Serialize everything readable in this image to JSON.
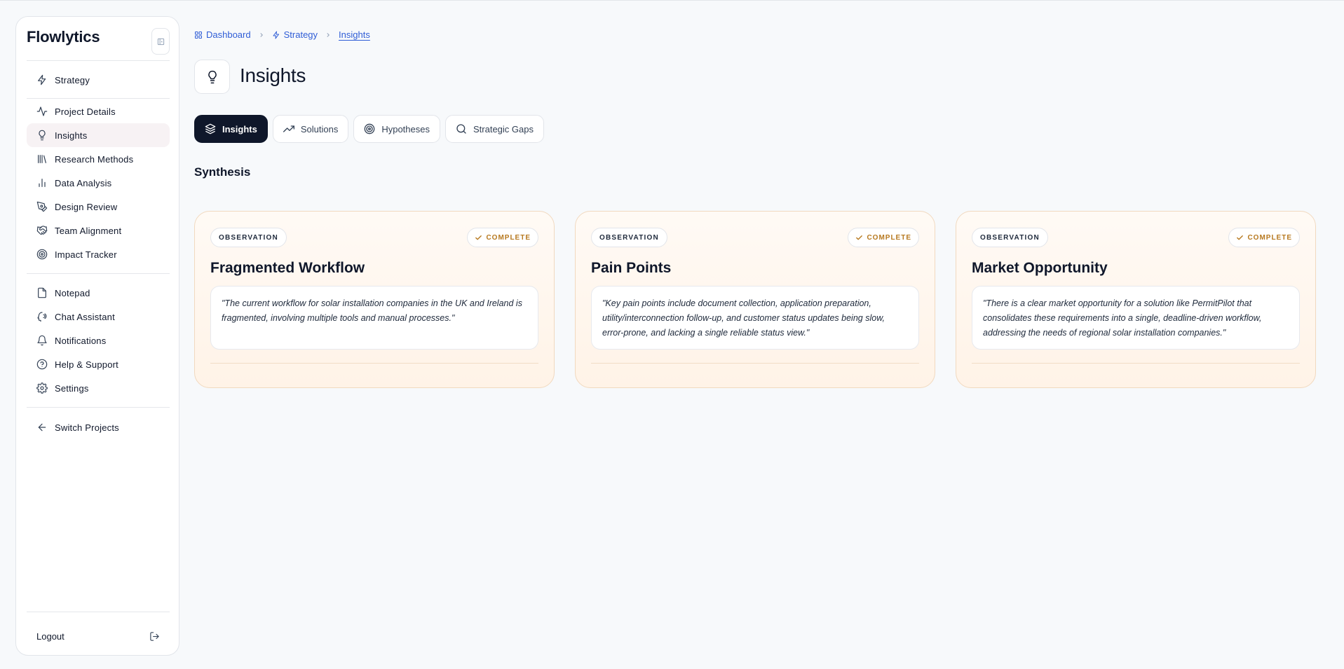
{
  "app": {
    "brand": "Flowlytics"
  },
  "sidebar": {
    "groups": [
      [
        {
          "label": "Strategy",
          "icon": "bolt-icon"
        }
      ],
      [
        {
          "label": "Project Details",
          "icon": "activity-icon"
        },
        {
          "label": "Insights",
          "icon": "lightbulb-icon",
          "active": true
        },
        {
          "label": "Research Methods",
          "icon": "library-icon"
        },
        {
          "label": "Data Analysis",
          "icon": "bar-chart-icon"
        },
        {
          "label": "Design Review",
          "icon": "pen-tool-icon"
        },
        {
          "label": "Team Alignment",
          "icon": "handshake-icon"
        },
        {
          "label": "Impact Tracker",
          "icon": "target-icon"
        }
      ],
      [
        {
          "label": "Notepad",
          "icon": "file-icon"
        },
        {
          "label": "Chat Assistant",
          "icon": "chat-assistant-icon"
        },
        {
          "label": "Notifications",
          "icon": "bell-icon"
        },
        {
          "label": "Help & Support",
          "icon": "help-circle-icon"
        },
        {
          "label": "Settings",
          "icon": "gear-icon"
        }
      ],
      [
        {
          "label": "Switch Projects",
          "icon": "arrow-left-icon"
        }
      ]
    ],
    "logout_label": "Logout"
  },
  "breadcrumb": [
    {
      "label": "Dashboard",
      "icon": "grid-icon"
    },
    {
      "label": "Strategy",
      "icon": "bolt-icon"
    },
    {
      "label": "Insights",
      "current": true
    }
  ],
  "page": {
    "title": "Insights",
    "icon": "lightbulb-icon"
  },
  "tabs": [
    {
      "label": "Insights",
      "icon": "layers-icon",
      "active": true
    },
    {
      "label": "Solutions",
      "icon": "trending-up-icon"
    },
    {
      "label": "Hypotheses",
      "icon": "target-icon"
    },
    {
      "label": "Strategic Gaps",
      "icon": "search-icon"
    }
  ],
  "section": {
    "title": "Synthesis"
  },
  "cards": [
    {
      "badge": "OBSERVATION",
      "status": "COMPLETE",
      "title": "Fragmented Workflow",
      "quote": "\"The current workflow for solar installation companies in the UK and Ireland is fragmented, involving multiple tools and manual processes.\""
    },
    {
      "badge": "OBSERVATION",
      "status": "COMPLETE",
      "title": "Pain Points",
      "quote": "\"Key pain points include document collection, application preparation, utility/interconnection follow-up, and customer status updates being slow, error-prone, and lacking a single reliable status view.\""
    },
    {
      "badge": "OBSERVATION",
      "status": "COMPLETE",
      "title": "Market Opportunity",
      "quote": "\"There is a clear market opportunity for a solution like PermitPilot that consolidates these requirements into a single, deadline-driven workflow, addressing the needs of regional solar installation companies.\""
    }
  ],
  "colors": {
    "accent": "#0f172a",
    "link": "#2f5dd6",
    "status": "#b7791f",
    "active_nav": "#f7f2f4",
    "card_border": "#f1d9bf"
  }
}
